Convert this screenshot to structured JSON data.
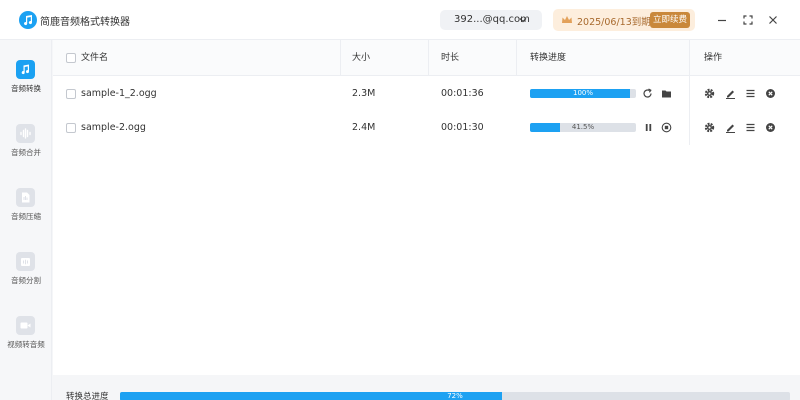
{
  "app": {
    "title": "简鹿音频格式转换器"
  },
  "account": {
    "email": "392...@qq.com"
  },
  "vip": {
    "expiry": "2025/06/13到期",
    "renew_label": "立即续费"
  },
  "colors": {
    "accent": "#1da1f2",
    "vip_bg": "#fdeedd",
    "vip_btn": "#c9883b"
  },
  "sidebar": {
    "items": [
      {
        "label": "音频转换",
        "icon": "music-note-icon",
        "active": true
      },
      {
        "label": "音频合并",
        "icon": "audio-wave-icon",
        "active": false
      },
      {
        "label": "音频压缩",
        "icon": "compress-file-icon",
        "active": false
      },
      {
        "label": "音频分割",
        "icon": "split-icon",
        "active": false
      },
      {
        "label": "视频转音频",
        "icon": "video-icon",
        "active": false
      }
    ]
  },
  "table": {
    "headers": {
      "name": "文件名",
      "size": "大小",
      "duration": "时长",
      "progress": "转换进度",
      "actions": "操作"
    },
    "rows": [
      {
        "name": "sample-1_2.ogg",
        "size": "2.3M",
        "duration": "00:01:36",
        "progress_text": "100%",
        "progress": 0.94,
        "status": "done"
      },
      {
        "name": "sample-2.ogg",
        "size": "2.4M",
        "duration": "00:01:30",
        "progress_text": "41.5%",
        "progress": 0.28,
        "status": "converting"
      }
    ]
  },
  "footer": {
    "label": "转换总进度",
    "progress_text": "72%",
    "progress": 0.57
  }
}
